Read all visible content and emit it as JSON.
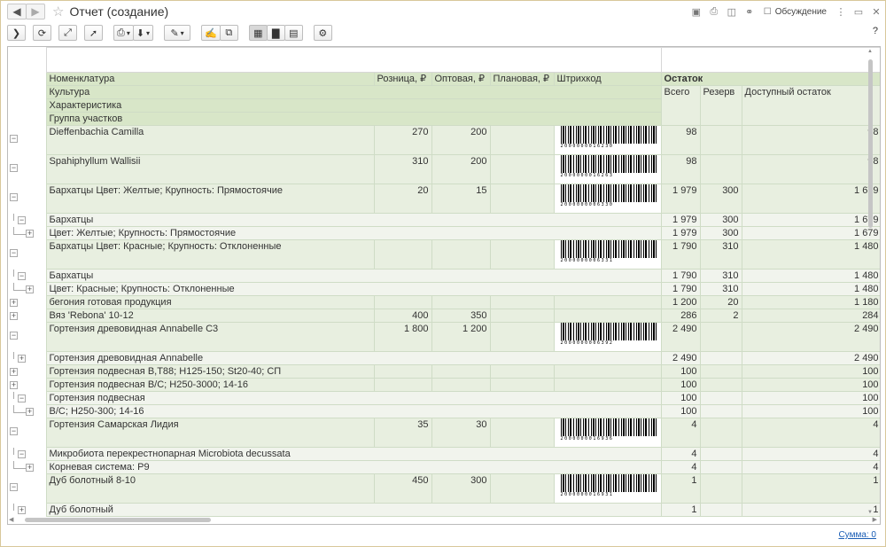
{
  "window": {
    "title": "Отчет (создание)",
    "discussion_label": "Обсуждение",
    "help_label": "?"
  },
  "icons": {
    "back": "◀",
    "forward": "▶",
    "star": "☆",
    "save": "▣",
    "print": "⎙",
    "preview": "◫",
    "link": "⚭",
    "discuss": "☐",
    "more": "⋮",
    "restore": "▭",
    "close": "✕",
    "arrow_right": "❯",
    "refresh": "⟳",
    "resize": "⤢",
    "pointer": "➚",
    "printer": "⎙",
    "download": "⬇",
    "brush": "✎",
    "edit": "✍",
    "copy": "⧉",
    "table_view": "▦",
    "chart_view": "▇",
    "form_view": "▤",
    "settings": "⚙",
    "caret": "▾"
  },
  "header": {
    "nomenclature": "Номенклатура",
    "retail": "Розница, ₽",
    "wholesale": "Оптовая, ₽",
    "planned": "Плановая, ₽",
    "barcode": "Штрихкод",
    "culture": "Культура",
    "characteristic": "Характеристика",
    "plot_group": "Группа участков",
    "balance": "Остаток",
    "total": "Всего",
    "reserve": "Резерв",
    "available": "Доступный остаток"
  },
  "rows": [
    {
      "type": "item",
      "name": "Dieffenbachia Camilla",
      "retail": "270",
      "wholesale": "200",
      "planned": "",
      "barcode": "2000000016230",
      "total": "98",
      "reserve": "",
      "available": "98"
    },
    {
      "type": "item",
      "name": "Spahiphyllum Wallisii",
      "retail": "310",
      "wholesale": "200",
      "planned": "",
      "barcode": "2000000016263",
      "total": "98",
      "reserve": "",
      "available": "98"
    },
    {
      "type": "item",
      "name": "Бархатцы Цвет: Желтые; Крупность: Прямостоячие",
      "retail": "20",
      "wholesale": "15",
      "planned": "",
      "barcode": "2000000006330",
      "total": "1 979",
      "reserve": "300",
      "available": "1 679"
    },
    {
      "type": "sub1",
      "name": "Бархатцы",
      "total": "1 979",
      "reserve": "300",
      "available": "1 679"
    },
    {
      "type": "sub2",
      "name": "Цвет: Желтые; Крупность: Прямостоячие",
      "total": "1 979",
      "reserve": "300",
      "available": "1 679"
    },
    {
      "type": "item",
      "name": "Бархатцы Цвет: Красные; Крупность: Отклоненные",
      "retail": "",
      "wholesale": "",
      "planned": "",
      "barcode": "2000000006331",
      "total": "1 790",
      "reserve": "310",
      "available": "1 480"
    },
    {
      "type": "sub1",
      "name": "Бархатцы",
      "total": "1 790",
      "reserve": "310",
      "available": "1 480"
    },
    {
      "type": "sub2",
      "name": "Цвет: Красные; Крупность: Отклоненные",
      "total": "1 790",
      "reserve": "310",
      "available": "1 480"
    },
    {
      "type": "plain",
      "name": "бегония готовая продукция",
      "retail": "",
      "wholesale": "",
      "planned": "",
      "total": "1 200",
      "reserve": "20",
      "available": "1 180"
    },
    {
      "type": "plain",
      "name": "Вяз 'Rebona' 10-12",
      "retail": "400",
      "wholesale": "350",
      "planned": "",
      "total": "286",
      "reserve": "2",
      "available": "284"
    },
    {
      "type": "item",
      "name": "Гортензия  древовидная Annabelle С3",
      "retail": "1 800",
      "wholesale": "1 200",
      "planned": "",
      "barcode": "2000000006392",
      "total": "2 490",
      "reserve": "",
      "available": "2 490"
    },
    {
      "type": "sub1",
      "name": "Гортензия  древовидная Annabelle",
      "total": "2 490",
      "reserve": "",
      "available": "2 490"
    },
    {
      "type": "plain",
      "name": "Гортензия подвесная В,Т88; Н125-150; St20-40; СП",
      "retail": "",
      "wholesale": "",
      "planned": "",
      "total": "100",
      "reserve": "",
      "available": "100"
    },
    {
      "type": "plain",
      "name": "Гортензия подвесная В/С; Н250-3000; 14-16",
      "retail": "",
      "wholesale": "",
      "planned": "",
      "total": "100",
      "reserve": "",
      "available": "100"
    },
    {
      "type": "sub1",
      "name": "Гортензия подвесная",
      "total": "100",
      "reserve": "",
      "available": "100"
    },
    {
      "type": "sub2",
      "name": "В/С; Н250-300; 14-16",
      "total": "100",
      "reserve": "",
      "available": "100"
    },
    {
      "type": "item",
      "name": "Гортензия Самарская Лидия",
      "retail": "35",
      "wholesale": "30",
      "planned": "",
      "barcode": "2000000016936",
      "total": "4",
      "reserve": "",
      "available": "4"
    },
    {
      "type": "sub1",
      "name": "Микробиота перекрестнопарная Microbiota decussata",
      "total": "4",
      "reserve": "",
      "available": "4"
    },
    {
      "type": "sub2",
      "name": "Корневая система: Р9",
      "total": "4",
      "reserve": "",
      "available": "4"
    },
    {
      "type": "item",
      "name": "Дуб болотный 8-10",
      "retail": "450",
      "wholesale": "300",
      "planned": "",
      "barcode": "2000000016931",
      "total": "1",
      "reserve": "",
      "available": "1"
    },
    {
      "type": "sub1",
      "name": "Дуб болотный",
      "total": "1",
      "reserve": "",
      "available": "1"
    }
  ],
  "footer": {
    "sum_label": "Сумма: 0"
  }
}
